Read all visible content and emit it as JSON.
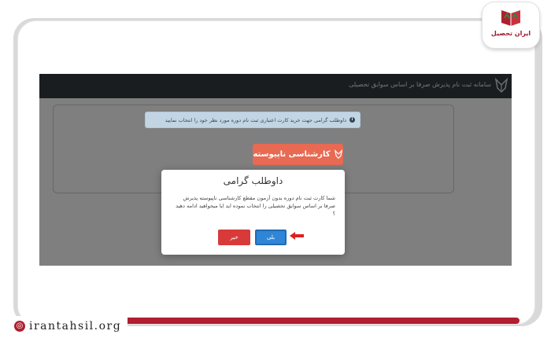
{
  "brand": {
    "logo_text": "ایران تحصیل",
    "website": "irantahsil.org"
  },
  "screen": {
    "topbar_title": "سامانه ثبت نام پذیرش صرفا بر اساس سوابق تحصیلی",
    "alert_text": "داوطلب گرامی جهت خرید کارت اعتباری ثبت نام دوره مورد نظر خود را انتخاب نمایید",
    "alert_icon": "info-icon",
    "course_button_label": "کارشناسی ناپیوسته"
  },
  "modal": {
    "title": "داوطلب گرامی",
    "body": "شما کارت ثبت نام دوره بدون آزمون مقطع کارشناسی ناپیوسته پذیرش صرفا بر اساس سوابق تحصیلی را انتخاب نموده اید ایا میخواهید ادامه دهید ؟",
    "yes_label": "بلی",
    "no_label": "خیر"
  },
  "colors": {
    "brand_red": "#b01e2f",
    "topbar": "#343a40",
    "yes_button": "#2f86d6",
    "no_button": "#d83a3a",
    "course_button": "#e86a52"
  }
}
